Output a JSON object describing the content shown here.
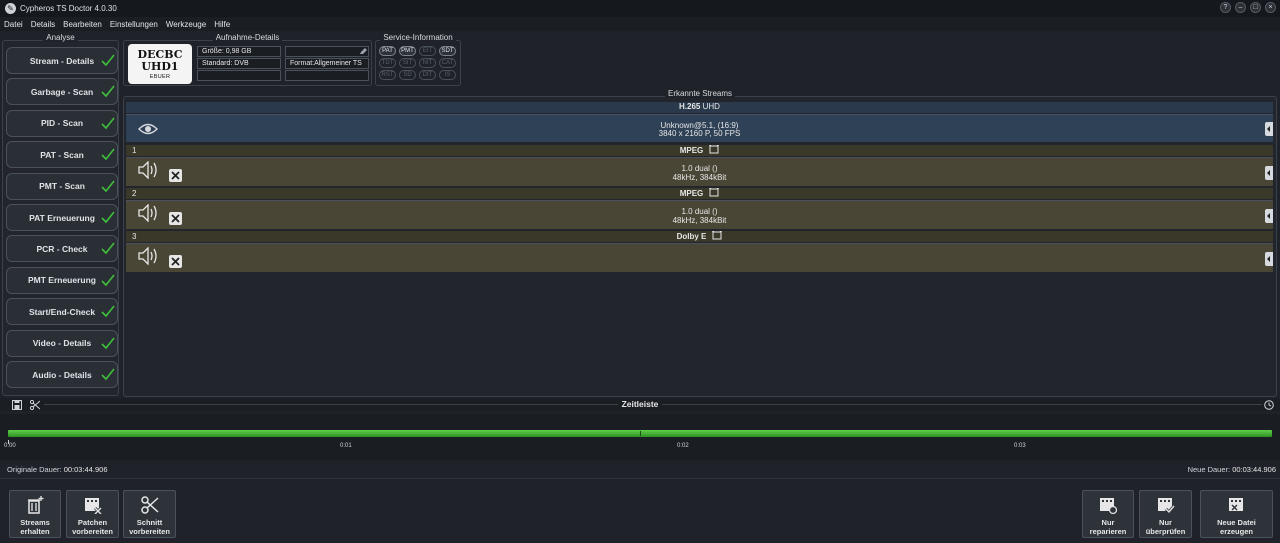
{
  "window": {
    "title": "Cypheros TS Doctor 4.0.30"
  },
  "menu": [
    "Datei",
    "Details",
    "Bearbeiten",
    "Einstellungen",
    "Werkzeuge",
    "Hilfe"
  ],
  "analyse": {
    "title": "Analyse",
    "buttons": [
      "Stream - Details",
      "Garbage - Scan",
      "PID - Scan",
      "PAT - Scan",
      "PMT - Scan",
      "PAT Erneuerung",
      "PCR - Check",
      "PMT Erneuerung",
      "Start/End-Check",
      "Video - Details",
      "Audio - Details"
    ]
  },
  "aufnahme": {
    "title": "Aufnahme-Details",
    "logo": {
      "line1": "DECBC",
      "line2": "UHD1",
      "line3": "EBUER"
    },
    "groesse": "Größe:  0,98 GB",
    "standard": "Standard:  DVB",
    "format": "Format:Allgemeiner TS"
  },
  "service": {
    "title": "Service-Information",
    "tags": [
      "PAT",
      "PMT",
      "EIT",
      "SDT",
      "TDT",
      "SIT",
      "NIT",
      "CAT",
      "RST",
      "SD",
      "DIT",
      "IS"
    ]
  },
  "streams": {
    "title": "Erkannte Streams",
    "video": {
      "codec": "H.265",
      "codec_suffix": "UHD",
      "line1": "Unknown@5.1,  (16:9)",
      "line2": "3840 x 2160 P, 50 FPS"
    },
    "audio": [
      {
        "num": "1",
        "codec": "MPEG",
        "line1": "1.0 dual ()",
        "line2": "48kHz, 384kBit"
      },
      {
        "num": "2",
        "codec": "MPEG",
        "line1": "1.0 dual ()",
        "line2": "48kHz, 384kBit"
      },
      {
        "num": "3",
        "codec": "Dolby E",
        "line1": "",
        "line2": ""
      }
    ]
  },
  "timeline": {
    "title": "Zeitleiste",
    "ticks": [
      "0:00",
      "0:01",
      "0:02",
      "0:03"
    ],
    "orig_label": "Originale Dauer:",
    "orig_value": "00:03:44.906",
    "new_label": "Neue Dauer:",
    "new_value": "00:03:44.906"
  },
  "bottom_left": [
    {
      "line1": "Streams",
      "line2": "erhalten"
    },
    {
      "line1": "Patchen",
      "line2": "vorbereiten"
    },
    {
      "line1": "Schnitt",
      "line2": "vorbereiten"
    }
  ],
  "bottom_right": [
    {
      "line1": "Nur",
      "line2": "reparieren"
    },
    {
      "line1": "Nur",
      "line2": "überprüfen"
    },
    {
      "line1": "Neue Datei",
      "line2": "erzeugen"
    }
  ],
  "colors": {
    "check": "#3fbf3a",
    "timeline": "#3fae30",
    "video_row": "#2f4157",
    "audio_row": "#4a4636"
  }
}
